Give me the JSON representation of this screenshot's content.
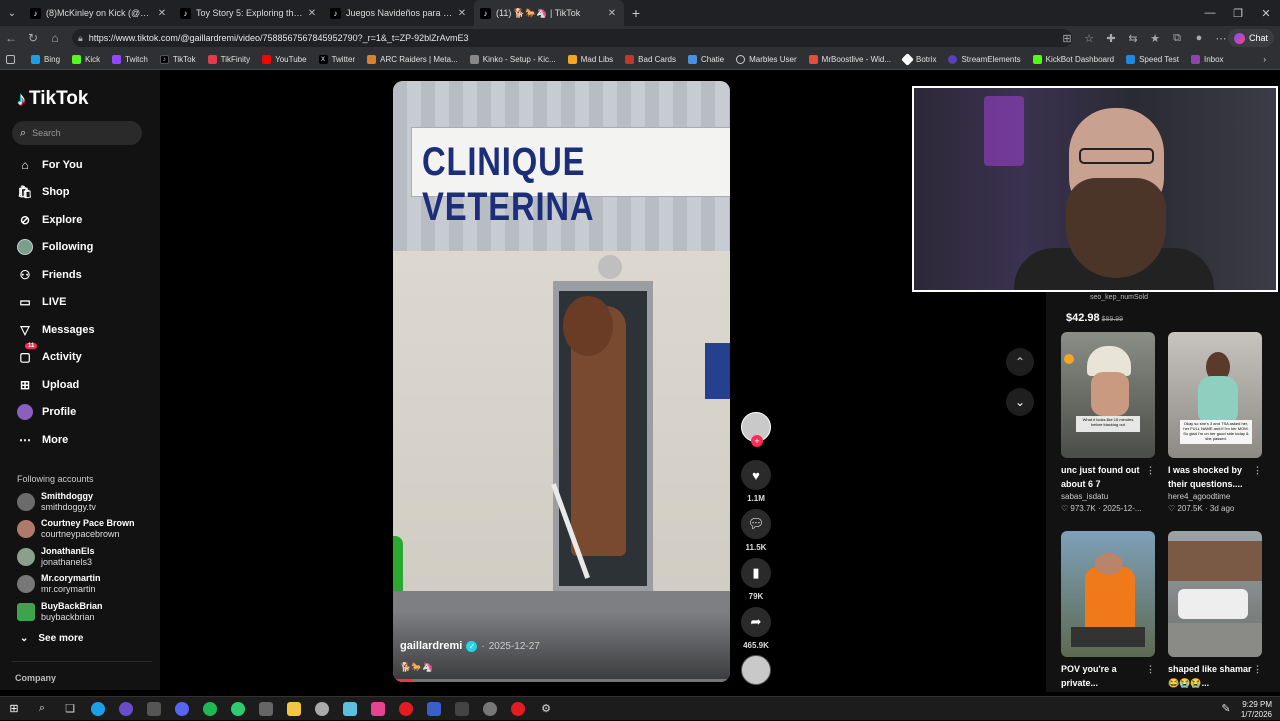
{
  "browser": {
    "tabs": [
      {
        "title": "(8)McKinley on Kick (@mckinley.tv)"
      },
      {
        "title": "Toy Story 5: Exploring the World of"
      },
      {
        "title": "Juegos Navideños para una Cena"
      },
      {
        "title": "(11) 🐕🐎🦄 | TikTok"
      }
    ],
    "url": "https://www.tiktok.com/@gaillardremi/video/7588567567845952790?_r=1&_t=ZP-92blZrAvmE3",
    "chat_label": "Chat",
    "bookmarks": [
      "Bing",
      "Kick",
      "Twitch",
      "TikTok",
      "TikFinity",
      "YouTube",
      "Twitter",
      "ARC Raiders | Meta...",
      "Kinko - Setup - Kic...",
      "Mad Libs",
      "Bad Cards",
      "Chatie",
      "Marbles User",
      "MrBoostlive - Wid...",
      "Botrix",
      "StreamElements",
      "KickBot Dashboard",
      "Speed Test",
      "Inbox"
    ]
  },
  "sidebar": {
    "logo": "TikTok",
    "search_placeholder": "Search",
    "nav": [
      {
        "label": "For You"
      },
      {
        "label": "Shop"
      },
      {
        "label": "Explore"
      },
      {
        "label": "Following"
      },
      {
        "label": "Friends"
      },
      {
        "label": "LIVE"
      },
      {
        "label": "Messages"
      },
      {
        "label": "Activity",
        "badge": "11"
      },
      {
        "label": "Upload"
      },
      {
        "label": "Profile"
      },
      {
        "label": "More"
      }
    ],
    "following_title": "Following accounts",
    "accounts": [
      {
        "name": "Smithdoggy",
        "handle": "smithdoggy.tv"
      },
      {
        "name": "Courtney Pace Brown",
        "handle": "courtneypacebrown"
      },
      {
        "name": "JonathanEls",
        "handle": "jonathanels3"
      },
      {
        "name": "Mr.corymartin",
        "handle": "mr.corymartin"
      },
      {
        "name": "BuyBackBrian",
        "handle": "buybackbrian"
      }
    ],
    "see_more": "See more",
    "company": "Company"
  },
  "video": {
    "sign_text": "CLINIQUE VETERINA",
    "username": "gaillardremi",
    "date": "2025-12-27",
    "caption": "🐕🐎🦄",
    "progress": 0.06
  },
  "actions": {
    "likes": "1.1M",
    "comments": "11.5K",
    "saves": "79K",
    "shares": "465.9K"
  },
  "promo": {
    "name": "seo_kep_numSold",
    "price": "$42.98",
    "old_price": "$89.99"
  },
  "cards": [
    {
      "title": "unc just found out about 6 7",
      "author": "sabas_isdatu",
      "likes": "973.7K",
      "date": "2025-12-...",
      "overlay": "What it looks like 15 minutes before blacking out"
    },
    {
      "title": "I was shocked by their questions....",
      "author": "here4_agoodtime",
      "likes": "207.5K",
      "date": "3d ago",
      "overlay": "Okay so she's 3 and TSA asked her, her FULL NAME and if I'm her MOM. So glad I'm on her good side today & she passed."
    },
    {
      "title": "POV you're a private...",
      "author": "",
      "likes": "",
      "date": "",
      "overlay": ""
    },
    {
      "title": "shaped like shamar 😂😭😭...",
      "author": "",
      "likes": "",
      "date": "",
      "overlay": ""
    }
  ],
  "taskbar": {
    "time": "9:29 PM",
    "date": "1/7/2026"
  },
  "colors": {
    "accent": "#fe2c55",
    "verified": "#20d5ec",
    "sidebar_bg": "#121212"
  }
}
